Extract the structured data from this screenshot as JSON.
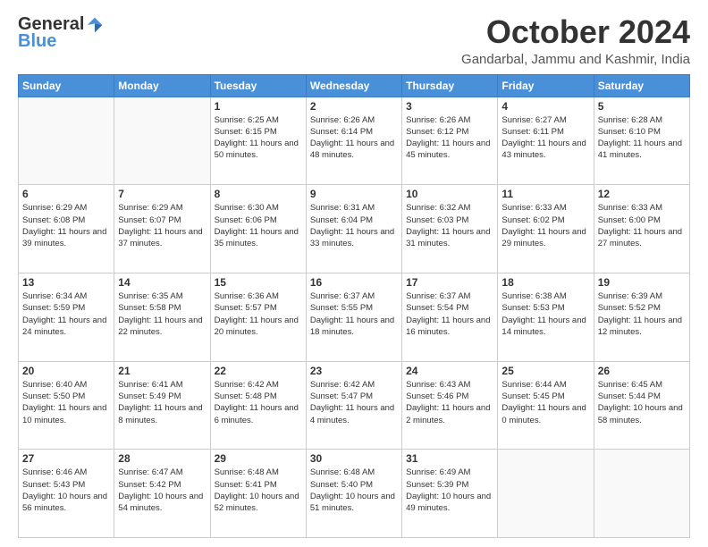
{
  "header": {
    "logo_general": "General",
    "logo_blue": "Blue",
    "month_title": "October 2024",
    "location": "Gandarbal, Jammu and Kashmir, India"
  },
  "days_of_week": [
    "Sunday",
    "Monday",
    "Tuesday",
    "Wednesday",
    "Thursday",
    "Friday",
    "Saturday"
  ],
  "weeks": [
    [
      {
        "day": "",
        "info": ""
      },
      {
        "day": "",
        "info": ""
      },
      {
        "day": "1",
        "info": "Sunrise: 6:25 AM\nSunset: 6:15 PM\nDaylight: 11 hours and 50 minutes."
      },
      {
        "day": "2",
        "info": "Sunrise: 6:26 AM\nSunset: 6:14 PM\nDaylight: 11 hours and 48 minutes."
      },
      {
        "day": "3",
        "info": "Sunrise: 6:26 AM\nSunset: 6:12 PM\nDaylight: 11 hours and 45 minutes."
      },
      {
        "day": "4",
        "info": "Sunrise: 6:27 AM\nSunset: 6:11 PM\nDaylight: 11 hours and 43 minutes."
      },
      {
        "day": "5",
        "info": "Sunrise: 6:28 AM\nSunset: 6:10 PM\nDaylight: 11 hours and 41 minutes."
      }
    ],
    [
      {
        "day": "6",
        "info": "Sunrise: 6:29 AM\nSunset: 6:08 PM\nDaylight: 11 hours and 39 minutes."
      },
      {
        "day": "7",
        "info": "Sunrise: 6:29 AM\nSunset: 6:07 PM\nDaylight: 11 hours and 37 minutes."
      },
      {
        "day": "8",
        "info": "Sunrise: 6:30 AM\nSunset: 6:06 PM\nDaylight: 11 hours and 35 minutes."
      },
      {
        "day": "9",
        "info": "Sunrise: 6:31 AM\nSunset: 6:04 PM\nDaylight: 11 hours and 33 minutes."
      },
      {
        "day": "10",
        "info": "Sunrise: 6:32 AM\nSunset: 6:03 PM\nDaylight: 11 hours and 31 minutes."
      },
      {
        "day": "11",
        "info": "Sunrise: 6:33 AM\nSunset: 6:02 PM\nDaylight: 11 hours and 29 minutes."
      },
      {
        "day": "12",
        "info": "Sunrise: 6:33 AM\nSunset: 6:00 PM\nDaylight: 11 hours and 27 minutes."
      }
    ],
    [
      {
        "day": "13",
        "info": "Sunrise: 6:34 AM\nSunset: 5:59 PM\nDaylight: 11 hours and 24 minutes."
      },
      {
        "day": "14",
        "info": "Sunrise: 6:35 AM\nSunset: 5:58 PM\nDaylight: 11 hours and 22 minutes."
      },
      {
        "day": "15",
        "info": "Sunrise: 6:36 AM\nSunset: 5:57 PM\nDaylight: 11 hours and 20 minutes."
      },
      {
        "day": "16",
        "info": "Sunrise: 6:37 AM\nSunset: 5:55 PM\nDaylight: 11 hours and 18 minutes."
      },
      {
        "day": "17",
        "info": "Sunrise: 6:37 AM\nSunset: 5:54 PM\nDaylight: 11 hours and 16 minutes."
      },
      {
        "day": "18",
        "info": "Sunrise: 6:38 AM\nSunset: 5:53 PM\nDaylight: 11 hours and 14 minutes."
      },
      {
        "day": "19",
        "info": "Sunrise: 6:39 AM\nSunset: 5:52 PM\nDaylight: 11 hours and 12 minutes."
      }
    ],
    [
      {
        "day": "20",
        "info": "Sunrise: 6:40 AM\nSunset: 5:50 PM\nDaylight: 11 hours and 10 minutes."
      },
      {
        "day": "21",
        "info": "Sunrise: 6:41 AM\nSunset: 5:49 PM\nDaylight: 11 hours and 8 minutes."
      },
      {
        "day": "22",
        "info": "Sunrise: 6:42 AM\nSunset: 5:48 PM\nDaylight: 11 hours and 6 minutes."
      },
      {
        "day": "23",
        "info": "Sunrise: 6:42 AM\nSunset: 5:47 PM\nDaylight: 11 hours and 4 minutes."
      },
      {
        "day": "24",
        "info": "Sunrise: 6:43 AM\nSunset: 5:46 PM\nDaylight: 11 hours and 2 minutes."
      },
      {
        "day": "25",
        "info": "Sunrise: 6:44 AM\nSunset: 5:45 PM\nDaylight: 11 hours and 0 minutes."
      },
      {
        "day": "26",
        "info": "Sunrise: 6:45 AM\nSunset: 5:44 PM\nDaylight: 10 hours and 58 minutes."
      }
    ],
    [
      {
        "day": "27",
        "info": "Sunrise: 6:46 AM\nSunset: 5:43 PM\nDaylight: 10 hours and 56 minutes."
      },
      {
        "day": "28",
        "info": "Sunrise: 6:47 AM\nSunset: 5:42 PM\nDaylight: 10 hours and 54 minutes."
      },
      {
        "day": "29",
        "info": "Sunrise: 6:48 AM\nSunset: 5:41 PM\nDaylight: 10 hours and 52 minutes."
      },
      {
        "day": "30",
        "info": "Sunrise: 6:48 AM\nSunset: 5:40 PM\nDaylight: 10 hours and 51 minutes."
      },
      {
        "day": "31",
        "info": "Sunrise: 6:49 AM\nSunset: 5:39 PM\nDaylight: 10 hours and 49 minutes."
      },
      {
        "day": "",
        "info": ""
      },
      {
        "day": "",
        "info": ""
      }
    ]
  ]
}
